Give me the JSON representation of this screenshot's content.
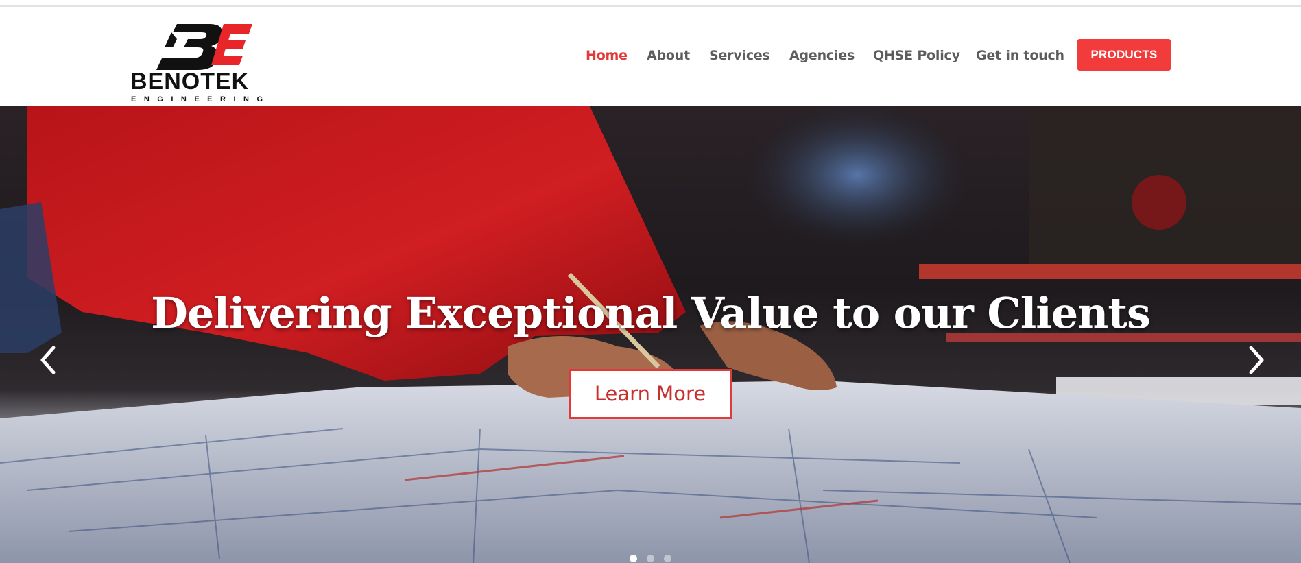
{
  "logo": {
    "initials": "BE",
    "name": "BENOTEK",
    "tagline": "ENGINEERING"
  },
  "nav": {
    "items": [
      {
        "label": "Home",
        "active": true
      },
      {
        "label": "About",
        "active": false
      },
      {
        "label": "Services",
        "active": false
      },
      {
        "label": "Agencies",
        "active": false
      },
      {
        "label": "QHSE Policy",
        "active": false
      },
      {
        "label": "Get in touch",
        "active": false
      }
    ],
    "cta_label": "PRODUCTS"
  },
  "hero": {
    "title": "Delivering Exceptional Value to our Clients",
    "button_label": "Learn More",
    "slides_total": 3,
    "active_slide": 1,
    "prev_icon": "chevron-left-icon",
    "next_icon": "chevron-right-icon"
  },
  "colors": {
    "accent": "#e23a3a",
    "cta_bg": "#f23b3b",
    "nav_text": "#5d5d5d",
    "logo_black": "#111111",
    "logo_red": "#e8262a"
  }
}
